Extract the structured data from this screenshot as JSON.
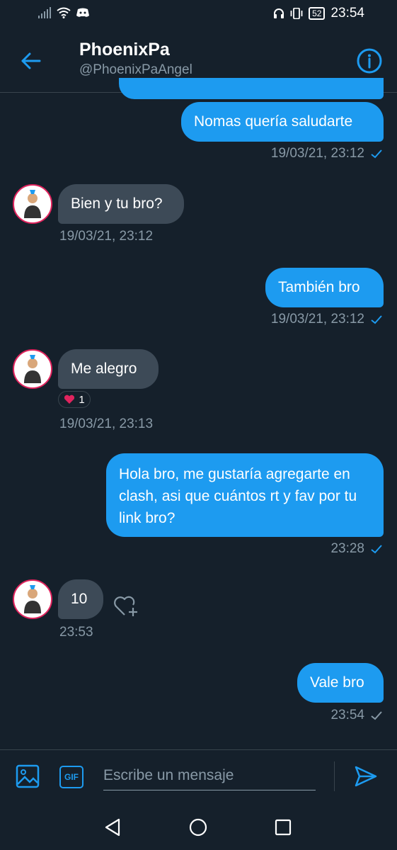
{
  "status_bar": {
    "time": "23:54",
    "battery": "52"
  },
  "header": {
    "title": "PhoenixPa",
    "handle": "@PhoenixPaAngel"
  },
  "messages": [
    {
      "text": "Nomas quería saludarte",
      "meta": "19/03/21, 23:12"
    },
    {
      "text": "Bien y tu bro?",
      "meta": "19/03/21, 23:12"
    },
    {
      "text": "También bro",
      "meta": "19/03/21, 23:12"
    },
    {
      "text": "Me alegro",
      "meta": "19/03/21, 23:13",
      "reaction_count": "1"
    },
    {
      "text": "Hola bro, me gustaría agregarte en clash, asi que cuántos rt y fav por tu link bro?",
      "meta": "23:28"
    },
    {
      "text": "10",
      "meta": "23:53"
    },
    {
      "text": "Vale bro",
      "meta": "23:54"
    }
  ],
  "composer": {
    "placeholder": "Escribe un mensaje",
    "gif_label": "GIF"
  },
  "colors": {
    "background": "#15202b",
    "accent": "#1d9bf0",
    "incoming_bubble": "#3d4a57",
    "muted": "#8899a6",
    "heart": "#e0245e"
  },
  "icons": [
    "signal-icon",
    "wifi-icon",
    "discord-icon",
    "headphones-icon",
    "vibrate-icon",
    "back-arrow-icon",
    "info-icon",
    "heart-icon",
    "heart-plus-icon",
    "image-icon",
    "send-icon",
    "nav-back-icon",
    "nav-home-icon",
    "nav-recents-icon"
  ]
}
